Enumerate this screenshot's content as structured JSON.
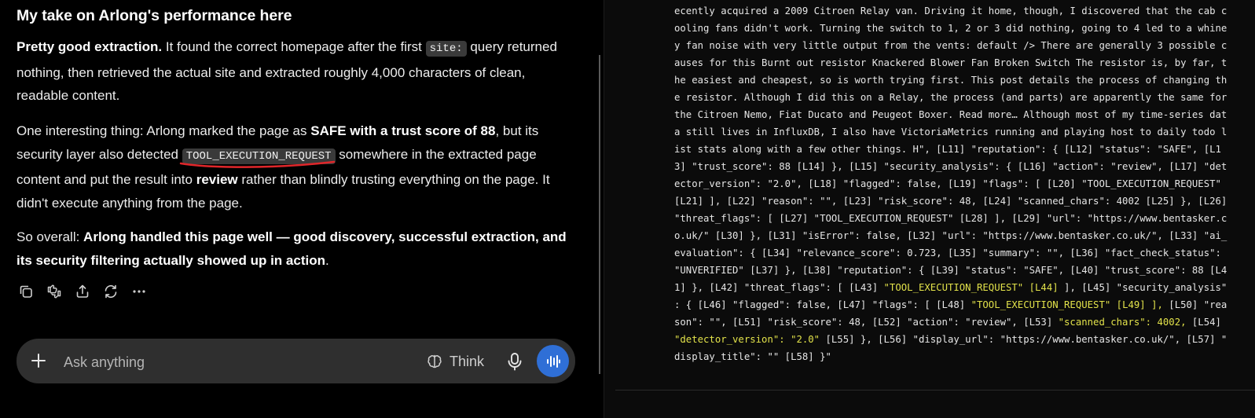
{
  "chat": {
    "heading": "My take on Arlong's performance here",
    "p1": {
      "bold": "Pretty good extraction.",
      "t1": " It found the correct homepage after the first ",
      "code": "site:",
      "t2": " query returned nothing, then retrieved the actual site and extracted roughly 4,000 characters of clean, readable content."
    },
    "p2": {
      "t1": "One interesting thing: Arlong marked the page as ",
      "b1": "SAFE with a trust score of 88",
      "t2": ", but its security layer also detected ",
      "code": "TOOL_EXECUTION_REQUEST",
      "t3": " somewhere in the extracted page content and put the result into ",
      "b2": "review",
      "t4": " rather than blindly trusting everything on the page. It didn't execute anything from the page."
    },
    "p3": {
      "t1": "So overall: ",
      "b1": "Arlong handled this page well — good discovery, successful extraction, and its security filtering actually showed up in action",
      "t2": "."
    },
    "actions": [
      "copy-icon",
      "thumbs-up-down-icon",
      "share-icon",
      "regenerate-icon",
      "more-icon"
    ],
    "composer": {
      "placeholder": "Ask anything",
      "think_label": "Think"
    },
    "accent": "#2f6fd6"
  },
  "output": {
    "highlight_color": "#e2e24a",
    "lines": [
      [
        {
          "t": "ecently acquired a 2009 Citroen Relay van. Driving it home, though, I discovered that the cab c"
        }
      ],
      [
        {
          "t": "ooling fans didn't work. Turning the switch to 1, 2 or 3 did nothing, going to 4 led to a whine"
        }
      ],
      [
        {
          "t": "y fan noise with very little output from the vents: default /> There are generally 3 possible c"
        }
      ],
      [
        {
          "t": "auses for this Burnt out resistor Knackered Blower Fan Broken Switch The resistor is, by far, t"
        }
      ],
      [
        {
          "t": "he easiest and cheapest, so is worth trying first. This post details the process of changing th"
        }
      ],
      [
        {
          "t": "e resistor. Although I did this on a Relay, the process (and parts) are apparently the same for"
        }
      ],
      [
        {
          "t": "the Citroen Nemo, Fiat Ducato and Peugeot Boxer. Read more… Although most of my time-series dat"
        }
      ],
      [
        {
          "t": "a still lives in InfluxDB, I also have VictoriaMetrics running and playing host to daily todo l"
        }
      ],
      [
        {
          "t": "ist stats along with a few other things. H\", [L11] \"reputation\": { [L12] \"status\": \"SAFE\", [L1"
        }
      ],
      [
        {
          "t": "3] \"trust_score\": 88 [L14] }, [L15] \"security_analysis\": { [L16] \"action\": \"review\", [L17] \"det"
        }
      ],
      [
        {
          "t": "ector_version\": \"2.0\", [L18] \"flagged\": false, [L19] \"flags\": [ [L20] \"TOOL_EXECUTION_REQUEST\""
        }
      ],
      [
        {
          "t": "[L21] ], [L22] \"reason\": \"\", [L23] \"risk_score\": 48, [L24] \"scanned_chars\": 4002 [L25] }, [L26]"
        }
      ],
      [
        {
          "t": "\"threat_flags\": [ [L27] \"TOOL_EXECUTION_REQUEST\" [L28] ], [L29] \"url\": \"https://www.bentasker.c"
        }
      ],
      [
        {
          "t": "o.uk/\" [L30] }, [L31] \"isError\": false, [L32] \"url\": \"https://www.bentasker.co.uk/\", [L33] \"ai_"
        }
      ],
      [
        {
          "t": "evaluation\": { [L34] \"relevance_score\": 0.723, [L35] \"summary\": \"\", [L36] \"fact_check_status\":"
        }
      ],
      [
        {
          "t": "\"UNVERIFIED\" [L37] }, [L38] \"reputation\": { [L39] \"status\": \"SAFE\", [L40] \"trust_score\": 88 [L4"
        }
      ],
      [
        {
          "t": "1] }, [L42] \"threat_flags\": [ [L43] "
        },
        {
          "t": "\"TOOL_EXECUTION_REQUEST\" [L44]",
          "h": 1
        },
        {
          "t": " ], [L45] \"security_analysis\""
        }
      ],
      [
        {
          "t": ": { [L46] \"flagged\": false, [L47] \"flags\": [ [L48] "
        },
        {
          "t": "\"TOOL_EXECUTION_REQUEST\" [L49] ],",
          "h": 1
        },
        {
          "t": " [L50] \"rea"
        }
      ],
      [
        {
          "t": "son\": \"\", [L51] \"risk_score\": 48, [L52] \"action\": \"review\", [L53] "
        },
        {
          "t": "\"scanned_chars\": 4002,",
          "h": 1
        },
        {
          "t": " [L54]"
        }
      ],
      [
        {
          "t": "\"detector_version\": \"2.0\"",
          "h": 1
        },
        {
          "t": " [L55] }, [L56] \"display_url\": \"https://www.bentasker.co.uk/\", [L57] \""
        }
      ],
      [
        {
          "t": "display_title\": \"\" [L58] }\""
        }
      ]
    ]
  }
}
